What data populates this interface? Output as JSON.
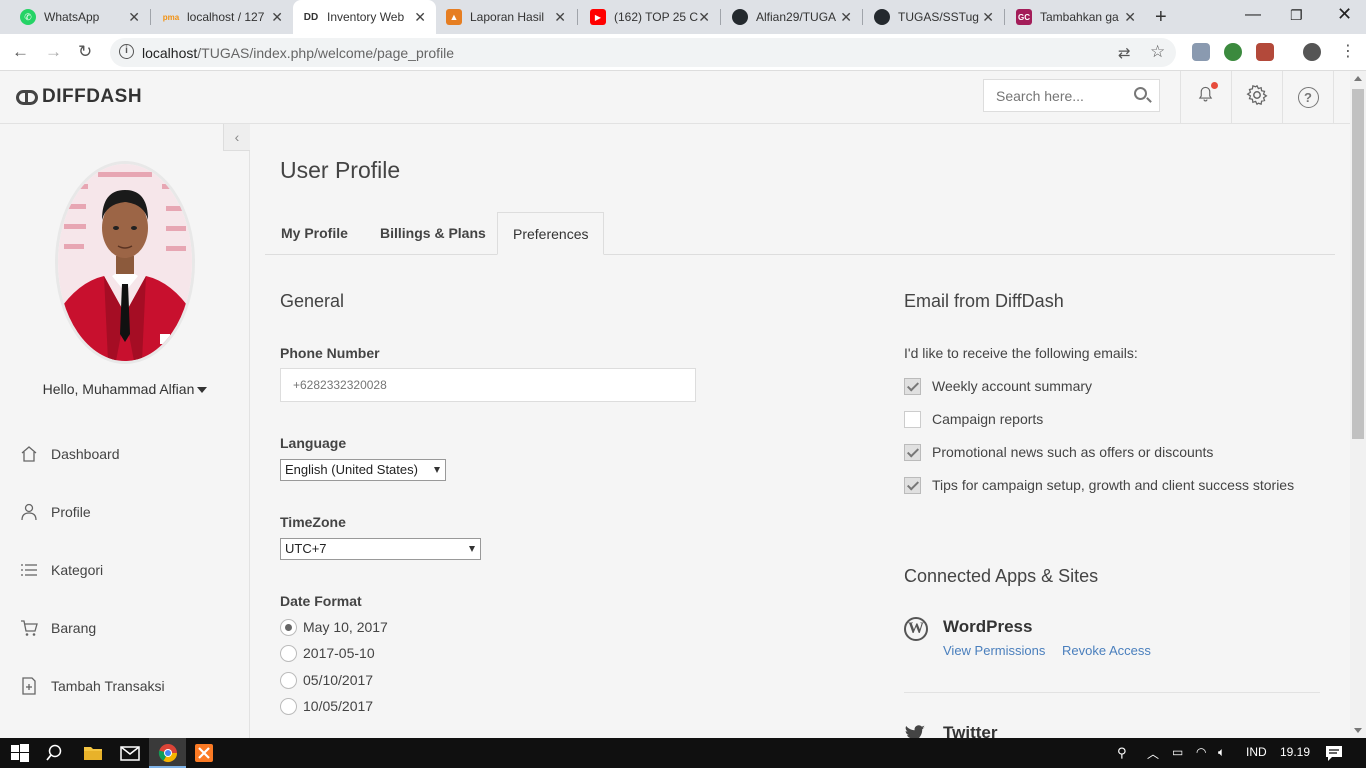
{
  "browser": {
    "tabs": [
      {
        "title": "WhatsApp",
        "favicon_color": "#25d366",
        "favicon_text": "✆"
      },
      {
        "title": "localhost / 127",
        "favicon_color": "#f29111",
        "favicon_text": "pma"
      },
      {
        "title": "Inventory Web",
        "favicon_color": "#ffffff",
        "favicon_text": "DD"
      },
      {
        "title": "Laporan Hasil",
        "favicon_color": "#e67e22",
        "favicon_text": "▲"
      },
      {
        "title": "(162) TOP 25 C",
        "favicon_color": "#ff0000",
        "favicon_text": "▶"
      },
      {
        "title": "Alfian29/TUGA",
        "favicon_color": "#24292e",
        "favicon_text": "●"
      },
      {
        "title": "TUGAS/SSTug",
        "favicon_color": "#24292e",
        "favicon_text": "●"
      },
      {
        "title": "Tambahkan ga",
        "favicon_color": "#a31d59",
        "favicon_text": "GC"
      }
    ],
    "active_tab": 2,
    "new_tab": "+",
    "url_host": "localhost",
    "url_path": "/TUGAS/index.php/welcome/page_profile"
  },
  "header": {
    "brand": "DIFFDASH",
    "search_placeholder": "Search here..."
  },
  "sidebar": {
    "greeting": "Hello, Muhammad Alfian",
    "collapse": "‹",
    "items": [
      {
        "label": "Dashboard",
        "icon": "home-icon"
      },
      {
        "label": "Profile",
        "icon": "user-icon"
      },
      {
        "label": "Kategori",
        "icon": "list-icon"
      },
      {
        "label": "Barang",
        "icon": "cart-icon"
      },
      {
        "label": "Tambah Transaksi",
        "icon": "add-doc-icon"
      }
    ]
  },
  "main": {
    "title": "User Profile",
    "tabs": [
      "My Profile",
      "Billings & Plans",
      "Preferences"
    ],
    "active_tab": "Preferences",
    "general": {
      "heading": "General",
      "phone_label": "Phone Number",
      "phone_placeholder": "+6282332320028",
      "language_label": "Language",
      "language_value": "English (United States)",
      "timezone_label": "TimeZone",
      "timezone_value": "UTC+7",
      "date_format_label": "Date Format",
      "date_formats": [
        {
          "label": "May 10, 2017",
          "checked": true
        },
        {
          "label": "2017-05-10",
          "checked": false
        },
        {
          "label": "05/10/2017",
          "checked": false
        },
        {
          "label": "10/05/2017",
          "checked": false
        }
      ]
    },
    "email": {
      "heading": "Email from DiffDash",
      "intro": "I'd like to receive the following emails:",
      "options": [
        {
          "label": "Weekly account summary",
          "checked": true
        },
        {
          "label": "Campaign reports",
          "checked": false
        },
        {
          "label": "Promotional news such as offers or discounts",
          "checked": true
        },
        {
          "label": "Tips for campaign setup, growth and client success stories",
          "checked": true
        }
      ]
    },
    "apps": {
      "heading": "Connected Apps & Sites",
      "items": [
        {
          "name": "WordPress",
          "view_label": "View Permissions",
          "revoke_label": "Revoke Access"
        },
        {
          "name": "Twitter"
        }
      ]
    }
  },
  "taskbar": {
    "lang": "IND",
    "time": "19.19"
  },
  "colors": {
    "link": "#4a7fbd",
    "notification": "#e74c3c"
  }
}
